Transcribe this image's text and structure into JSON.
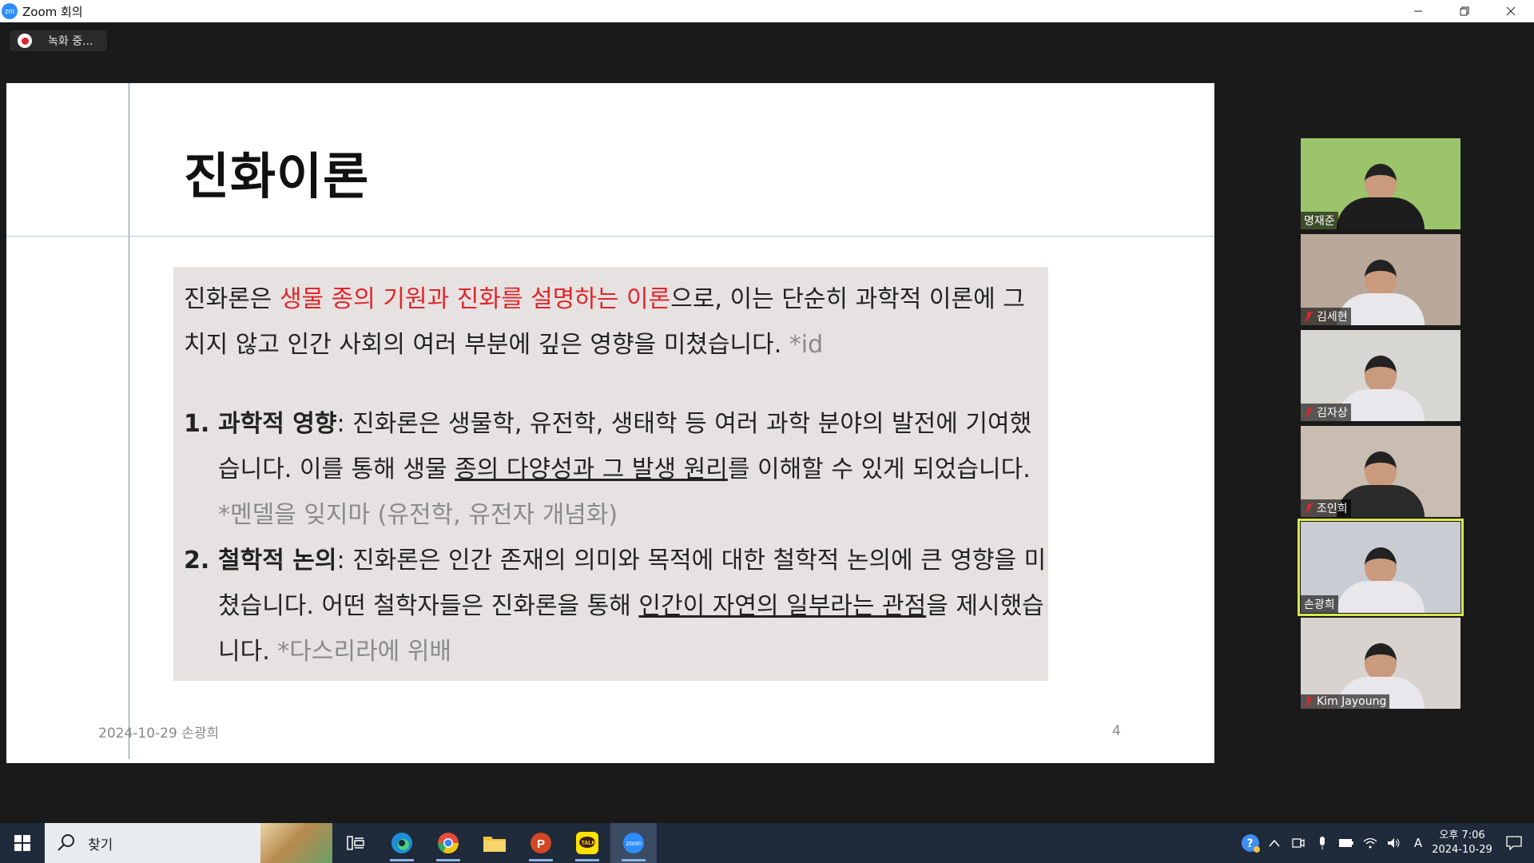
{
  "window": {
    "title": "Zoom 회의",
    "app_icon": "zm"
  },
  "recording": {
    "label": "녹화 중..."
  },
  "slide": {
    "title": "진화이론",
    "intro": {
      "pre": "진화론은 ",
      "highlight": "생물 종의 기원과 진화를 설명하는 이론",
      "post": "으로, 이는 단순히 과학적 이론에 그치지 않고 인간 사회의 여러 부분에 깊은 영향을 미쳤습니다. ",
      "note": "*id"
    },
    "items": [
      {
        "num": "1.",
        "term": "과학적 영향",
        "text1": ": 진화론은 생물학, 유전학, 생태학 등 여러 과학 분야의 발전에 기여했습니다. 이를 통해 생물 ",
        "underline": "종의 다양성과 그 발생 원리",
        "text2": "를 이해할 수 있게 되었습니다. ",
        "note": "*멘델을 잊지마 (유전학, 유전자 개념화)"
      },
      {
        "num": "2.",
        "term": "철학적 논의",
        "text1": ": 진화론은 인간 존재의 의미와 목적에 대한 철학적 논의에 큰 영향을 미쳤습니다. 어떤 철학자들은 진화론을 통해 ",
        "underline": "인간이 자연의 일부라는 관점",
        "text2": "을 제시했습니다. ",
        "note": "*다스리라에 위배"
      }
    ],
    "footer_date": "2024-10-29 손광희",
    "page_number": "4"
  },
  "participants": [
    {
      "name": "명재준",
      "muted": false,
      "active": false,
      "bg": "#9cc46a"
    },
    {
      "name": "김세현",
      "muted": true,
      "active": false,
      "bg": "#b9a79a"
    },
    {
      "name": "김자상",
      "muted": true,
      "active": false,
      "bg": "#d8d6d2"
    },
    {
      "name": "조인희",
      "muted": true,
      "active": false,
      "bg": "#c9bcb0"
    },
    {
      "name": "손광희",
      "muted": false,
      "active": true,
      "bg": "#c9ccd2"
    },
    {
      "name": "Kim Jayoung",
      "muted": true,
      "active": false,
      "bg": "#d9d3cf"
    }
  ],
  "taskbar": {
    "search_label": "찾기",
    "apps": [
      "task-view",
      "edge",
      "chrome",
      "file-explorer",
      "powerpoint",
      "kakaotalk",
      "zoom"
    ],
    "ime_label": "A",
    "time_ampm": "오후 7:06",
    "date": "2024-10-29"
  }
}
